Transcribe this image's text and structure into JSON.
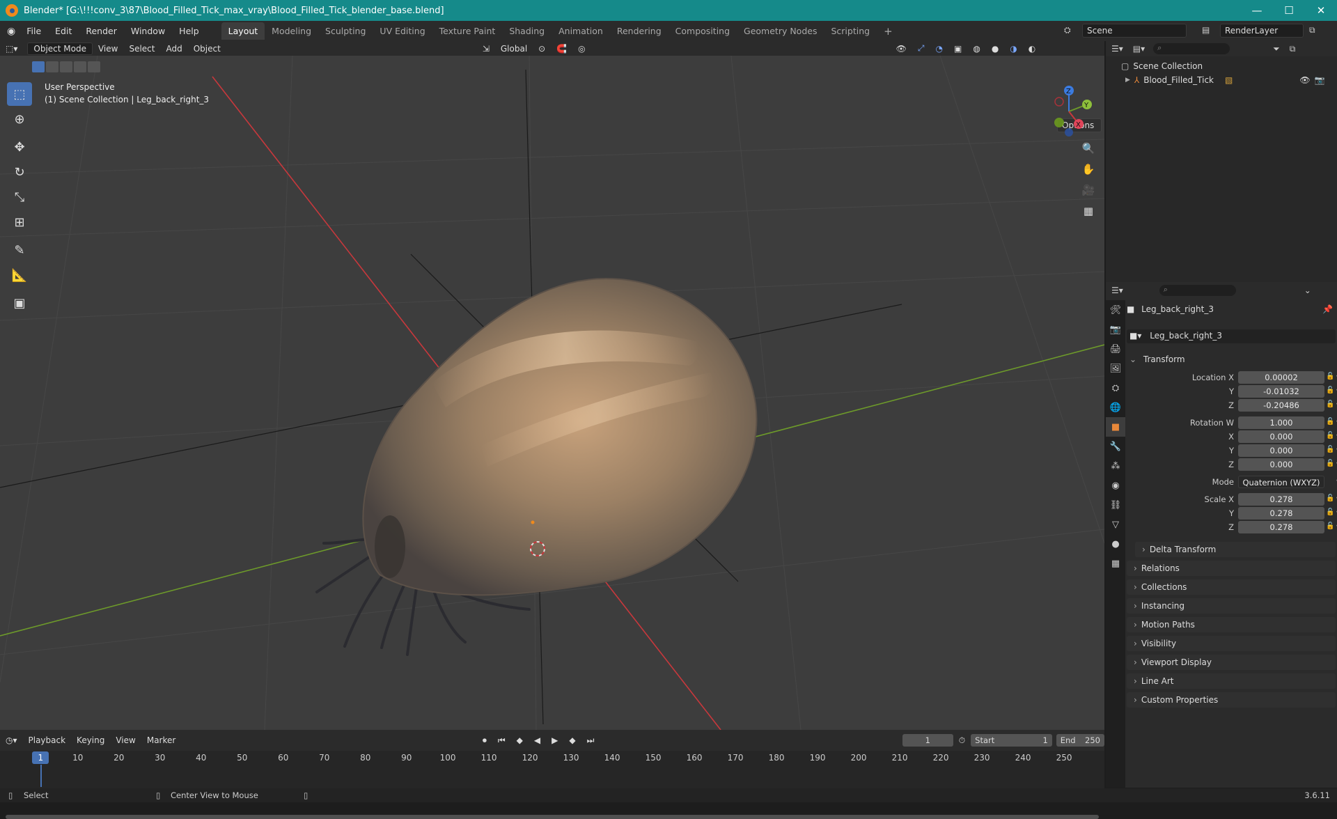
{
  "window": {
    "title": "Blender* [G:\\!!!conv_3\\87\\Blood_Filled_Tick_max_vray\\Blood_Filled_Tick_blender_base.blend]",
    "minimize": "—",
    "maximize": "☐",
    "close": "✕"
  },
  "menus": [
    "File",
    "Edit",
    "Render",
    "Window",
    "Help"
  ],
  "workspaces": [
    "Layout",
    "Modeling",
    "Sculpting",
    "UV Editing",
    "Texture Paint",
    "Shading",
    "Animation",
    "Rendering",
    "Compositing",
    "Geometry Nodes",
    "Scripting"
  ],
  "active_workspace": "Layout",
  "scene": {
    "name": "Scene",
    "render_layer": "RenderLayer"
  },
  "viewport_header": {
    "mode": "Object Mode",
    "menus": [
      "View",
      "Select",
      "Add",
      "Object"
    ],
    "orientation": "Global",
    "options": "Options"
  },
  "viewport_overlay": {
    "perspective": "User Perspective",
    "collection_path": "(1) Scene Collection | Leg_back_right_3"
  },
  "gizmo": {
    "x": "X",
    "y": "Y",
    "z": "Z"
  },
  "outliner": {
    "root": "Scene Collection",
    "items": [
      {
        "name": "Blood_Filled_Tick"
      }
    ]
  },
  "properties": {
    "object_name": "Leg_back_right_3",
    "object_field": "Leg_back_right_3",
    "transform_title": "Transform",
    "location": {
      "label_x": "Location X",
      "label_y": "Y",
      "label_z": "Z",
      "x": "0.00002",
      "y": "-0.01032",
      "z": "-0.20486"
    },
    "rotation": {
      "label_w": "Rotation W",
      "label_x": "X",
      "label_y": "Y",
      "label_z": "Z",
      "w": "1.000",
      "x": "0.000",
      "y": "0.000",
      "z": "0.000"
    },
    "mode_label": "Mode",
    "mode_value": "Quaternion (WXYZ)",
    "scale": {
      "label_x": "Scale X",
      "label_y": "Y",
      "label_z": "Z",
      "x": "0.278",
      "y": "0.278",
      "z": "0.278"
    },
    "delta_transform": "Delta Transform",
    "panels": [
      "Relations",
      "Collections",
      "Instancing",
      "Motion Paths",
      "Visibility",
      "Viewport Display",
      "Line Art",
      "Custom Properties"
    ]
  },
  "timeline": {
    "menus": [
      "Playback",
      "Keying",
      "View",
      "Marker"
    ],
    "current_frame": "1",
    "start_label": "Start",
    "start": "1",
    "end_label": "End",
    "end": "250",
    "ticks": [
      "1",
      "10",
      "20",
      "30",
      "40",
      "50",
      "60",
      "70",
      "80",
      "90",
      "100",
      "110",
      "120",
      "130",
      "140",
      "150",
      "160",
      "170",
      "180",
      "190",
      "200",
      "210",
      "220",
      "230",
      "240",
      "250"
    ]
  },
  "statusbar": {
    "left": "Select",
    "middle": "Center View to Mouse",
    "version": "3.6.11"
  },
  "colors": {
    "accent": "#4772b3",
    "x_axis": "#c8383c",
    "y_axis": "#6d9a2a",
    "titlebar": "#158a8a"
  }
}
